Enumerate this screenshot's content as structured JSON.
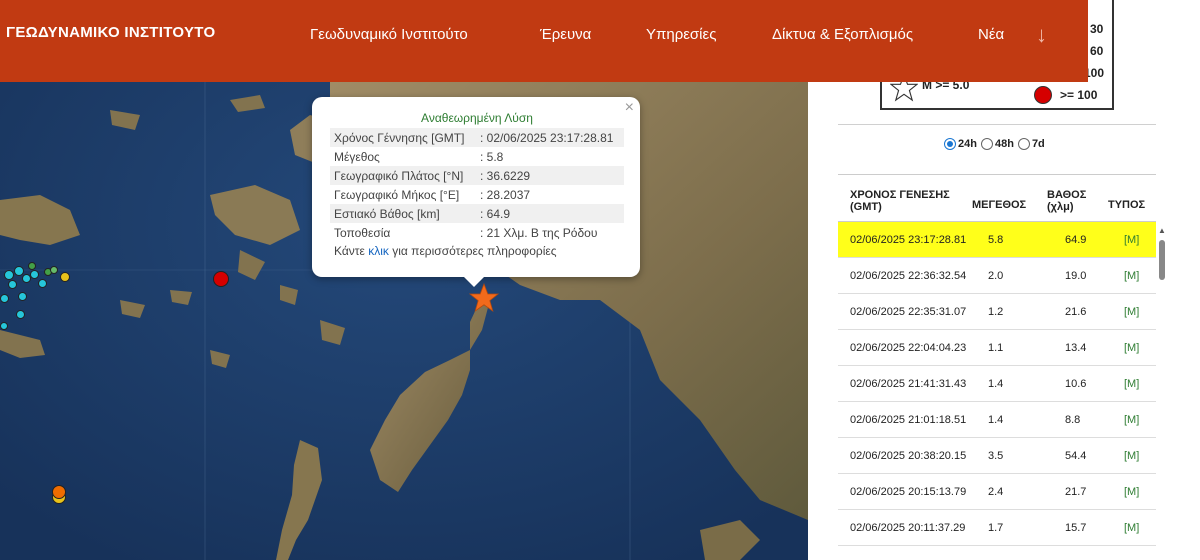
{
  "header": {
    "logo": "ΓΕΩΔΥΝΑΜΙΚΟ ΙΝΣΤΙΤΟΥΤΟ",
    "nav": [
      {
        "label": "Γεωδυναμικό Ινστιτούτο"
      },
      {
        "label": "Έρευνα"
      },
      {
        "label": "Υπηρεσίες"
      },
      {
        "label": "Δίκτυα & Εξοπλισμός"
      },
      {
        "label": "Νέα"
      }
    ],
    "more_icon": "arrow-down-icon"
  },
  "legend": {
    "star_label": "M >= 5.0",
    "depth_labels": [
      "30",
      "60",
      "100"
    ],
    "deep_label": ">= 100"
  },
  "popup": {
    "title": "Αναθεωρημένη Λύση",
    "rows": [
      {
        "k": "Χρόνος Γέννησης [GMT]",
        "v": ": 02/06/2025 23:17:28.81"
      },
      {
        "k": "Μέγεθος",
        "v": ": 5.8"
      },
      {
        "k": "Γεωγραφικό Πλάτος [°N]",
        "v": ": 36.6229"
      },
      {
        "k": "Γεωγραφικό Μήκος [°E]",
        "v": ": 28.2037"
      },
      {
        "k": "Εστιακό Βάθος [km]",
        "v": ": 64.9"
      },
      {
        "k": "Τοποθεσία",
        "v": ": 21 Χλμ. Β της Ρόδου"
      }
    ],
    "footer_pre": "Κάντε ",
    "footer_link": "κλικ",
    "footer_post": " για περισσότερες πληροφορίες",
    "close": "×"
  },
  "filters": {
    "options": [
      {
        "label": "24h",
        "selected": true
      },
      {
        "label": "48h",
        "selected": false
      },
      {
        "label": "7d",
        "selected": false
      }
    ]
  },
  "table": {
    "headers": {
      "time_1": "ΧΡΟΝΟΣ ΓΕΝΕΣΗΣ",
      "time_2": "(GMT)",
      "mag": "ΜΕΓΕΘΟΣ",
      "depth_1": "ΒΑΘΟΣ",
      "depth_2": "(χλμ)",
      "type": "ΤΥΠΟΣ"
    },
    "rows": [
      {
        "time": "02/06/2025 23:17:28.81",
        "mag": "5.8",
        "depth": "64.9",
        "type": "[M]",
        "highlight": true
      },
      {
        "time": "02/06/2025 22:36:32.54",
        "mag": "2.0",
        "depth": "19.0",
        "type": "[M]"
      },
      {
        "time": "02/06/2025 22:35:31.07",
        "mag": "1.2",
        "depth": "21.6",
        "type": "[M]"
      },
      {
        "time": "02/06/2025 22:04:04.23",
        "mag": "1.1",
        "depth": "13.4",
        "type": "[M]"
      },
      {
        "time": "02/06/2025 21:41:31.43",
        "mag": "1.4",
        "depth": "10.6",
        "type": "[M]"
      },
      {
        "time": "02/06/2025 21:01:18.51",
        "mag": "1.4",
        "depth": "8.8",
        "type": "[M]"
      },
      {
        "time": "02/06/2025 20:38:20.15",
        "mag": "3.5",
        "depth": "54.4",
        "type": "[M]"
      },
      {
        "time": "02/06/2025 20:15:13.79",
        "mag": "2.4",
        "depth": "21.7",
        "type": "[M]"
      },
      {
        "time": "02/06/2025 20:11:37.29",
        "mag": "1.7",
        "depth": "15.7",
        "type": "[M]"
      }
    ]
  },
  "colors": {
    "header_bg": "#c13a12",
    "sea": "#1d3d66",
    "land": "#8a7a5a",
    "highlight": "#ffff1a",
    "type_green": "#2e7d32",
    "star_orange": "#f26a1b"
  }
}
